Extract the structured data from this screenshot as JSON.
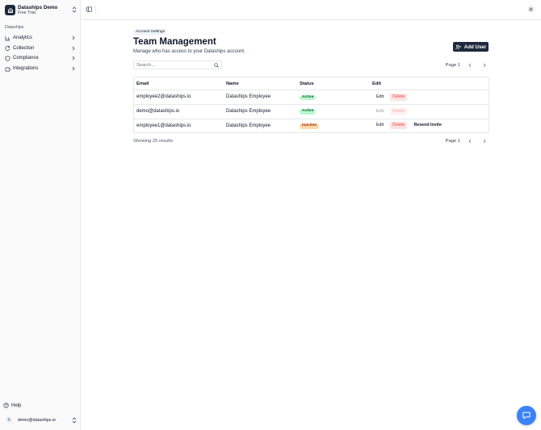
{
  "org": {
    "name": "Dataships Demo",
    "plan": "Free Trial"
  },
  "sidebar": {
    "section_label": "Dataships",
    "items": [
      {
        "label": "Analytics",
        "icon": "bar-chart-icon"
      },
      {
        "label": "Collection",
        "icon": "refresh-icon"
      },
      {
        "label": "Compliance",
        "icon": "shield-icon"
      },
      {
        "label": "Integrations",
        "icon": "puzzle-icon"
      }
    ],
    "help_label": "Help",
    "user": {
      "initial": "S",
      "email": "demo@dataships.io"
    }
  },
  "page": {
    "breadcrumb": "Account Settings",
    "title": "Team Management",
    "subtitle": "Manage who has access to your Dataships account.",
    "add_user_label": "Add User",
    "search_placeholder": "Search...",
    "page_label": "Page 1",
    "showing_text": "Showing 25 results"
  },
  "table": {
    "headers": {
      "email": "Email",
      "name": "Name",
      "status": "Status",
      "edit": "Edit"
    },
    "rows": [
      {
        "email": "employee2@dataships.io",
        "name": "Dataships Employee",
        "status": "Active",
        "status_type": "active",
        "edit": "Edit",
        "delete": "Delete",
        "resend": "",
        "disabled": false
      },
      {
        "email": "demo@dataships.io",
        "name": "Dataships Employee",
        "status": "Active",
        "status_type": "active",
        "edit": "Edit",
        "delete": "Delete",
        "resend": "",
        "disabled": true
      },
      {
        "email": "employee1@dataships.io",
        "name": "Dataships Employee",
        "status": "Inactive",
        "status_type": "inactive",
        "edit": "Edit",
        "delete": "Delete",
        "resend": "Resend Invite",
        "disabled": false
      }
    ]
  },
  "colors": {
    "primary": "#1e293b",
    "chat": "#3b82f6",
    "active_bg": "#bbf7d0",
    "inactive_bg": "#fed7aa",
    "delete_bg": "#fee2e2",
    "delete_text": "#ef4444"
  }
}
